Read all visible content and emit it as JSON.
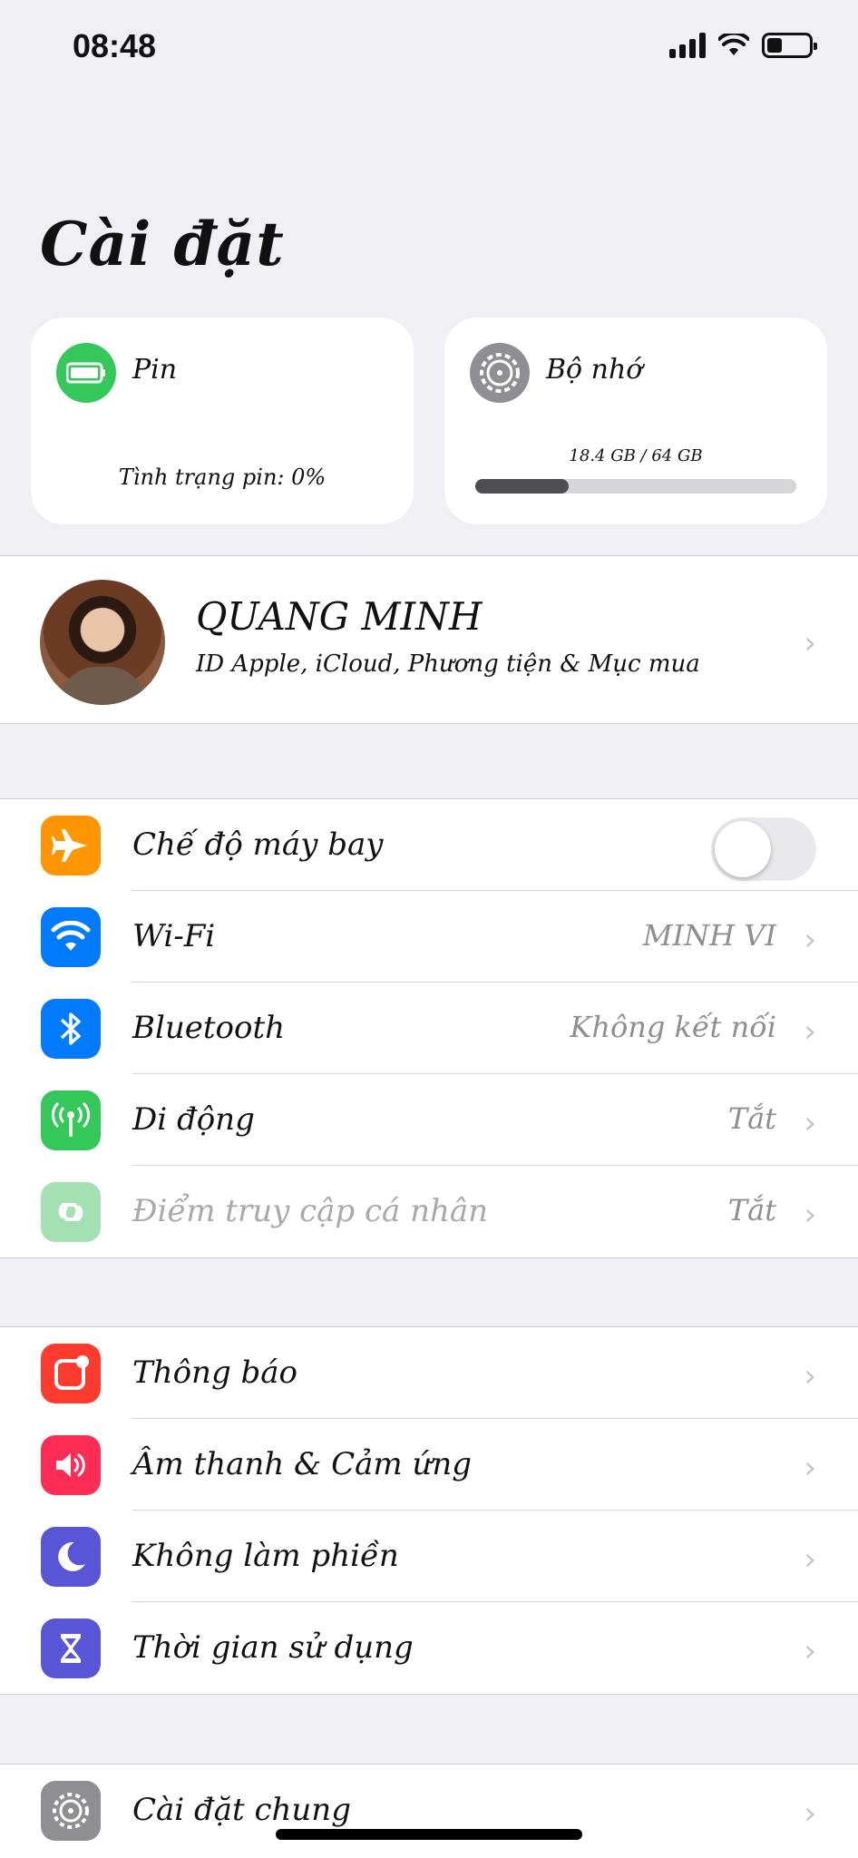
{
  "status": {
    "time": "08:48"
  },
  "header": {
    "title": "Cài đặt"
  },
  "cards": {
    "battery": {
      "label": "Pin",
      "status_text": "Tình trạng pin: 0%"
    },
    "storage": {
      "label": "Bộ nhớ",
      "usage_text": "18.4 GB / 64 GB",
      "used_fraction": 0.29
    }
  },
  "profile": {
    "name": "QUANG MINH",
    "subtitle": "ID Apple, iCloud, Phương tiện & Mục mua"
  },
  "connectivity": [
    {
      "label": "Chế độ máy bay",
      "toggle": false,
      "icon": "airplane-icon",
      "color": "#ff9500"
    },
    {
      "label": "Wi-Fi",
      "value": "MINH VI",
      "icon": "wifi-icon",
      "color": "#007aff"
    },
    {
      "label": "Bluetooth",
      "value": "Không kết nối",
      "icon": "bluetooth-icon",
      "color": "#007aff"
    },
    {
      "label": "Di động",
      "value": "Tắt",
      "icon": "cellular-icon",
      "color": "#34c759"
    },
    {
      "label": "Điểm truy cập cá nhân",
      "value": "Tắt",
      "icon": "hotspot-icon",
      "color": "#a3e0b2"
    }
  ],
  "notifications": [
    {
      "label": "Thông báo",
      "icon": "notifications-icon",
      "color": "#ff3b30"
    },
    {
      "label": "Âm thanh & Cảm ứng",
      "icon": "sound-icon",
      "color": "#ff2d55"
    },
    {
      "label": "Không làm phiền",
      "icon": "moon-icon",
      "color": "#5856d6"
    },
    {
      "label": "Thời gian sử dụng",
      "icon": "hourglass-icon",
      "color": "#5856d6"
    }
  ],
  "general": [
    {
      "label": "Cài đặt chung",
      "icon": "gear-icon",
      "color": "#8e8e93"
    }
  ]
}
